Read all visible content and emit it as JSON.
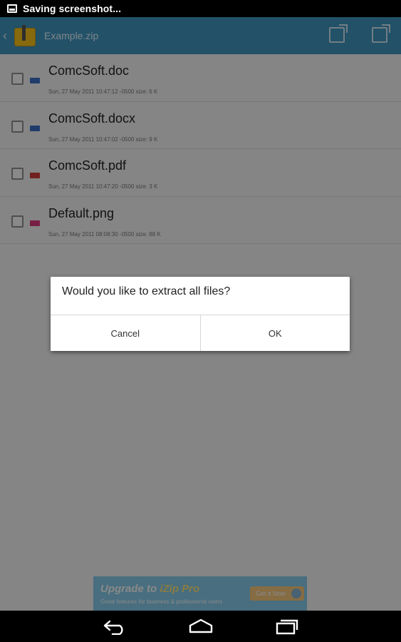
{
  "status_bar": {
    "text": "Saving screenshot..."
  },
  "action_bar": {
    "title": "Example.zip"
  },
  "files": [
    {
      "name": "ComcSoft.doc",
      "meta": "Sun, 27 May 2011 10:47:12 -0500   size: 6 K",
      "type_icon": "doc-file-icon",
      "color": "#3a6fc4"
    },
    {
      "name": "ComcSoft.docx",
      "meta": "Sun, 27 May 2011 10:47:02 -0500   size: 9 K",
      "type_icon": "docx-file-icon",
      "color": "#3a6fc4"
    },
    {
      "name": "ComcSoft.pdf",
      "meta": "Sun, 27 May 2011 10:47:20 -0500   size: 3 K",
      "type_icon": "pdf-file-icon",
      "color": "#d23b3b"
    },
    {
      "name": "Default.png",
      "meta": "Sun, 27 May 2011 08:08:30 -0500   size: 88 K",
      "type_icon": "png-file-icon",
      "color": "#d93a7a"
    }
  ],
  "dialog": {
    "message": "Would you like to extract all files?",
    "cancel": "Cancel",
    "ok": "OK"
  },
  "ad": {
    "title_prefix": "Upgrade to ",
    "title_highlight": "iZip Pro",
    "subtitle": "Great features for business & professional users",
    "button": "Get it Now"
  },
  "colors": {
    "action_bar": "#3e94bd",
    "ad_banner": "#29a9df"
  }
}
